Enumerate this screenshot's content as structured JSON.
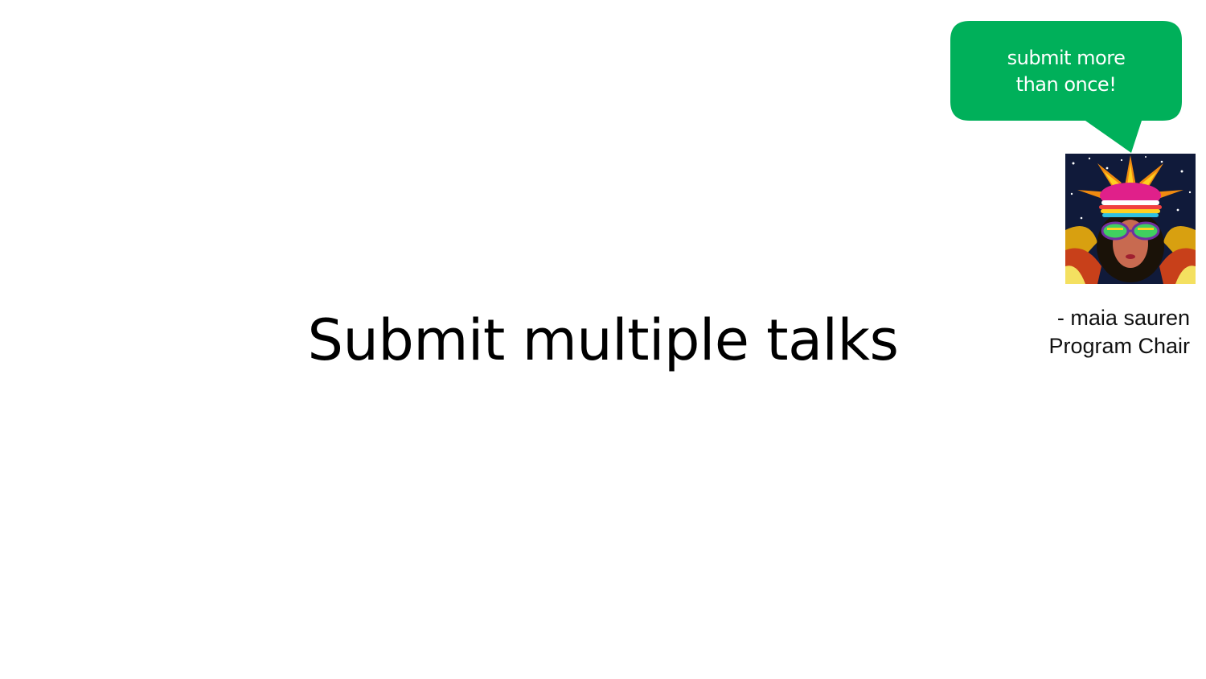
{
  "slide": {
    "title": "Submit multiple talks"
  },
  "speech_bubble": {
    "line1": "submit more",
    "line2": "than once!",
    "color": "#00b05a"
  },
  "attribution": {
    "name_line": "- maia sauren",
    "role_line": "Program Chair"
  },
  "portrait": {
    "icon": "psychedelic-portrait-avatar"
  }
}
